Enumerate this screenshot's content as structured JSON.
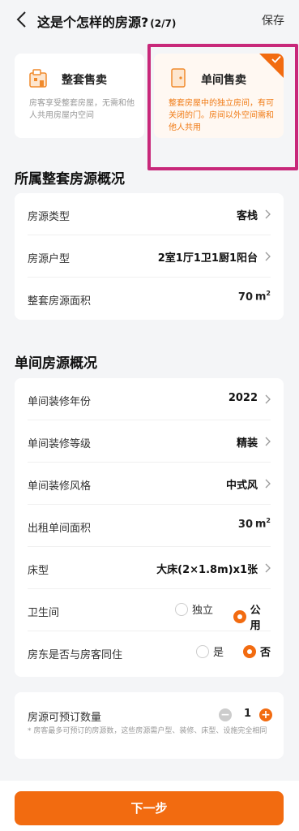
{
  "header": {
    "title": "这是个怎样的房源?",
    "step": "(2/7)",
    "save_label": "保存"
  },
  "options": [
    {
      "name": "整套售卖",
      "desc": "房客享受整套房屋，无需和他人共用房屋内空间",
      "selected": false
    },
    {
      "name": "单间售卖",
      "desc": "整套房屋中的独立房间，有可关闭的门。房间以外空间需和他人共用",
      "selected": true
    }
  ],
  "section1": {
    "title": "所属整套房源概况",
    "rows": [
      {
        "label": "房源类型",
        "value": "客栈"
      },
      {
        "label": "房源户型",
        "value": "2室1厅1卫1厨1阳台"
      },
      {
        "label": "整套房源面积",
        "value": "70",
        "unit": "m",
        "unit_sup": "2"
      }
    ]
  },
  "section2": {
    "title": "单间房源概况",
    "rows": [
      {
        "label": "单间装修年份",
        "value": "2022"
      },
      {
        "label": "单间装修等级",
        "value": "精装"
      },
      {
        "label": "单间装修风格",
        "value": "中式风"
      },
      {
        "label": "出租单间面积",
        "value": "30",
        "unit": "m",
        "unit_sup": "2"
      },
      {
        "label": "床型",
        "value": "大床(2×1.8m)x1张"
      }
    ],
    "bathroom": {
      "label": "卫生间",
      "opt1": "独立",
      "opt2": "公用",
      "selected": "公用"
    },
    "cohabit": {
      "label": "房东是否与房客同住",
      "opt1": "是",
      "opt2": "否",
      "selected": "否"
    }
  },
  "booking": {
    "label": "房源可预订数量",
    "value": "1",
    "minus": "−",
    "plus": "+",
    "note": "* 房客最多可预订的房源数，这些房源需户型、装修、床型、设施完全相同"
  },
  "next_label": "下一步",
  "colors": {
    "accent": "#f26b10",
    "annotation": "#c8287a"
  }
}
